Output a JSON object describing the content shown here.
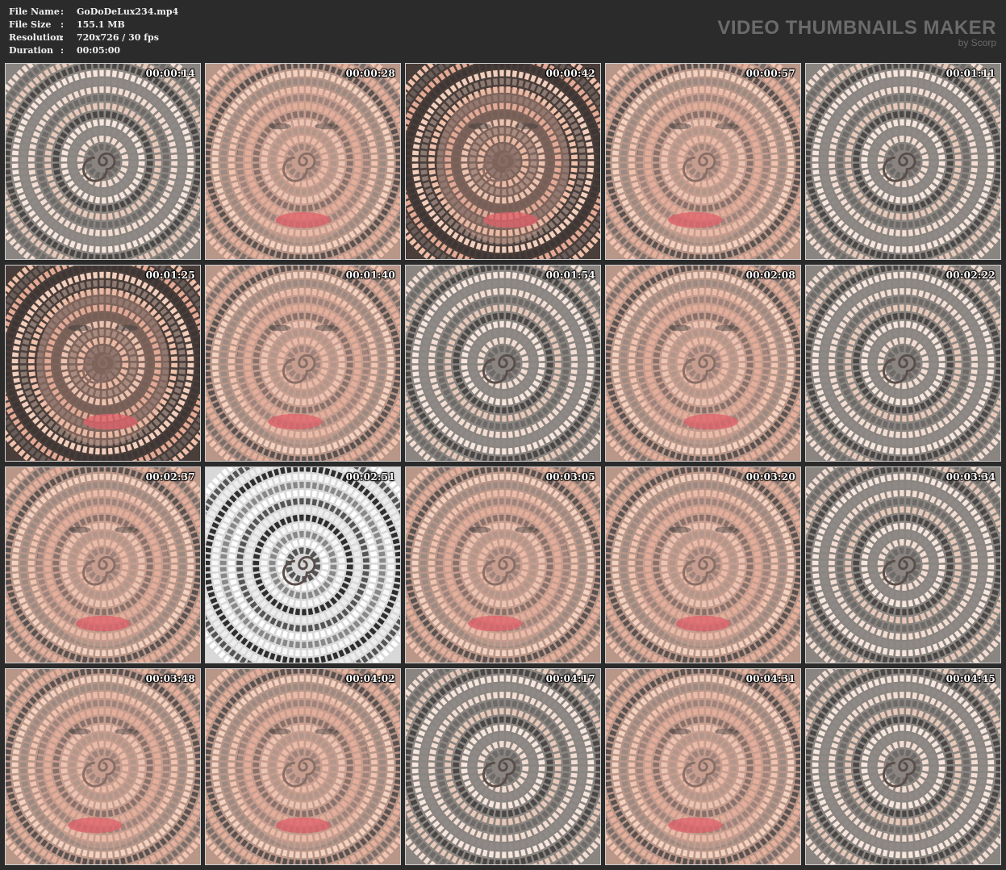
{
  "info": {
    "rows": [
      {
        "key": "File Name",
        "value": "GoDoDeLux234.mp4"
      },
      {
        "key": "File Size",
        "value": "155.1 MB"
      },
      {
        "key": "Resolution",
        "value": "720x726 / 30 fps"
      },
      {
        "key": "Duration",
        "value": "00:05:00"
      }
    ],
    "separator": ":"
  },
  "brand": {
    "title": "VIDEO THUMBNAILS MAKER",
    "subtitle": "by Scorp"
  },
  "thumbnails": [
    {
      "time": "00:00:14",
      "tone": "gray"
    },
    {
      "time": "00:00:28",
      "tone": "face"
    },
    {
      "time": "00:00:42",
      "tone": "face-dark"
    },
    {
      "time": "00:00:57",
      "tone": "face"
    },
    {
      "time": "00:01:11",
      "tone": "gray"
    },
    {
      "time": "00:01:25",
      "tone": "face-dark"
    },
    {
      "time": "00:01:40",
      "tone": "face"
    },
    {
      "time": "00:01:54",
      "tone": "gray"
    },
    {
      "time": "00:02:08",
      "tone": "face"
    },
    {
      "time": "00:02:22",
      "tone": "gray"
    },
    {
      "time": "00:02:37",
      "tone": "face"
    },
    {
      "time": "00:02:51",
      "tone": "mono"
    },
    {
      "time": "00:03:05",
      "tone": "face"
    },
    {
      "time": "00:03:20",
      "tone": "face"
    },
    {
      "time": "00:03:34",
      "tone": "gray"
    },
    {
      "time": "00:03:48",
      "tone": "face"
    },
    {
      "time": "00:04:02",
      "tone": "face"
    },
    {
      "time": "00:04:17",
      "tone": "gray"
    },
    {
      "time": "00:04:31",
      "tone": "face"
    },
    {
      "time": "00:04:45",
      "tone": "gray"
    }
  ],
  "colors": {
    "background": "#2b2b2b",
    "skin": "#e0ad9a",
    "lips": "#e0606a",
    "dark": "#3a3a3a"
  }
}
